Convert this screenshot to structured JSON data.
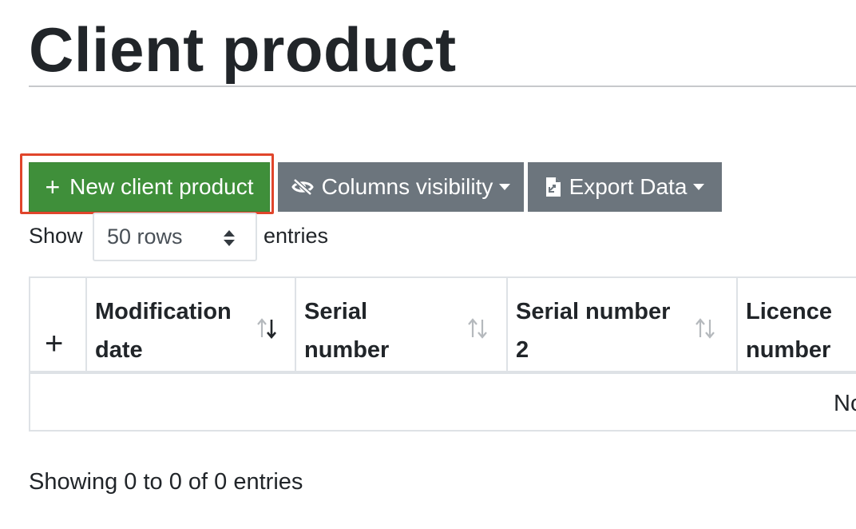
{
  "page": {
    "title": "Client product"
  },
  "toolbar": {
    "new_label": "New client product",
    "columns_label": "Columns visibility",
    "export_label": "Export Data"
  },
  "length_menu": {
    "show_label": "Show",
    "selected": "50 rows",
    "entries_label": "entries"
  },
  "table": {
    "columns": [
      {
        "line1": "Modification",
        "line2": "date"
      },
      {
        "line1": "Serial",
        "line2": "number"
      },
      {
        "line1": "Serial number",
        "line2": "2"
      },
      {
        "line1": "Licence",
        "line2": "number"
      }
    ],
    "empty_text": "No data available in table"
  },
  "info": {
    "text": "Showing 0 to 0 of 0 entries"
  },
  "colors": {
    "primary_button": "#3f8f3a",
    "secondary_button": "#6c757d",
    "highlight": "#e0452b"
  },
  "icons": {
    "new": "plus-icon",
    "columns": "eye-slash-icon",
    "export": "file-export-icon",
    "sort": "sort-arrows-icon"
  }
}
